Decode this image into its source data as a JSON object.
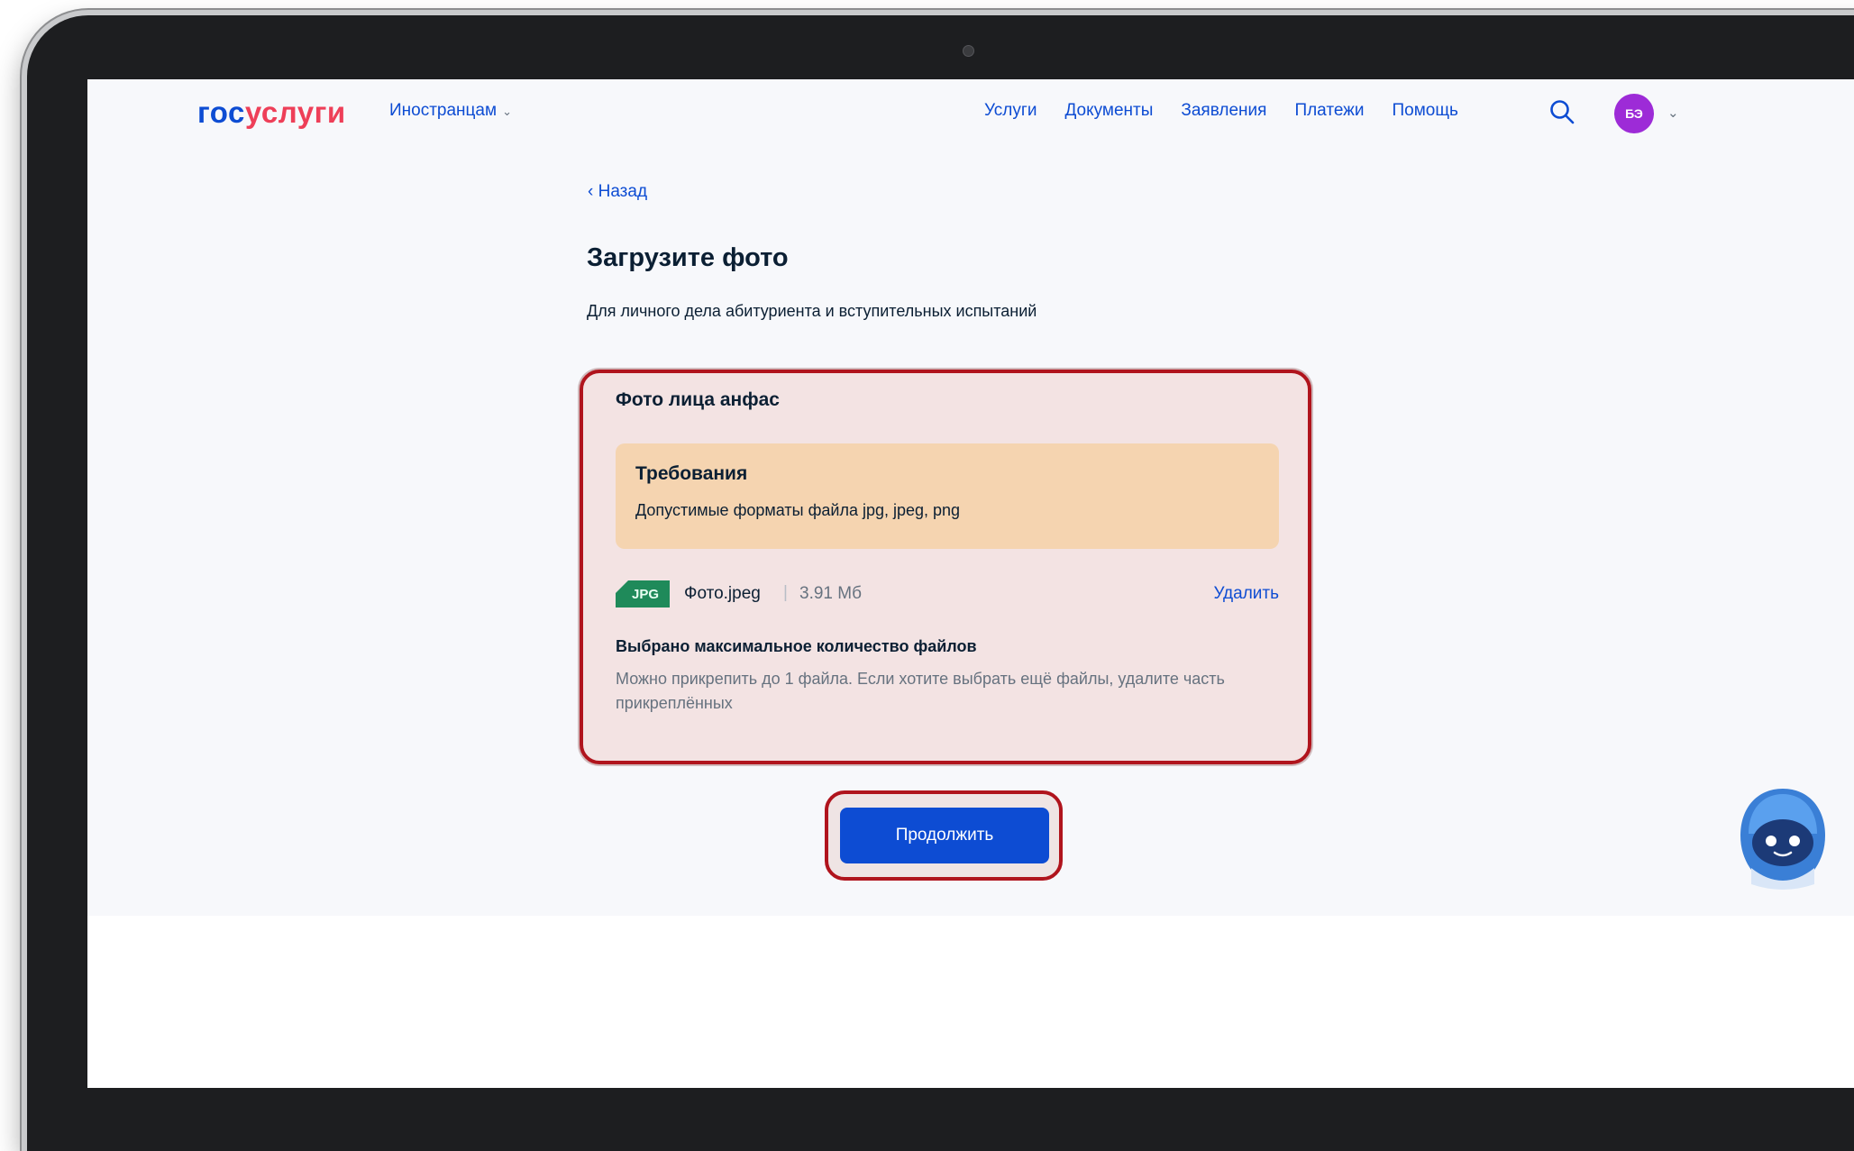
{
  "header": {
    "logo_gos": "гос",
    "logo_uslugi": "услуги",
    "language_menu": "Иностранцам",
    "nav": [
      "Услуги",
      "Документы",
      "Заявления",
      "Платежи",
      "Помощь"
    ],
    "avatar_initials": "БЭ"
  },
  "main": {
    "back_link": "Назад",
    "title": "Загрузите фото",
    "subtitle": "Для личного дела абитуриента и вступительных испытаний",
    "upload_card": {
      "title": "Фото лица анфас",
      "requirements_title": "Требования",
      "requirements_text": "Допустимые форматы файла jpg, jpeg, png",
      "file": {
        "badge": "JPG",
        "name": "Фото.jpeg",
        "separator": "|",
        "size": "3.91 Мб",
        "delete_label": "Удалить"
      },
      "limit_title": "Выбрано максимальное количество файлов",
      "limit_text": "Можно прикрепить до 1 файла. Если хотите выбрать ещё файлы, удалите часть прикреплённых"
    },
    "continue_button": "Продолжить"
  },
  "colors": {
    "accent": "#0d4cd3",
    "logo_red": "#ee3f58",
    "highlight": "#b0141d",
    "requirements_bg": "#f5d4b0",
    "badge_green": "#1f8a5a",
    "avatar": "#9d2bd7"
  },
  "icons": [
    "search-icon",
    "chevron-down-icon",
    "chevron-left-icon",
    "robot-assistant-icon"
  ]
}
